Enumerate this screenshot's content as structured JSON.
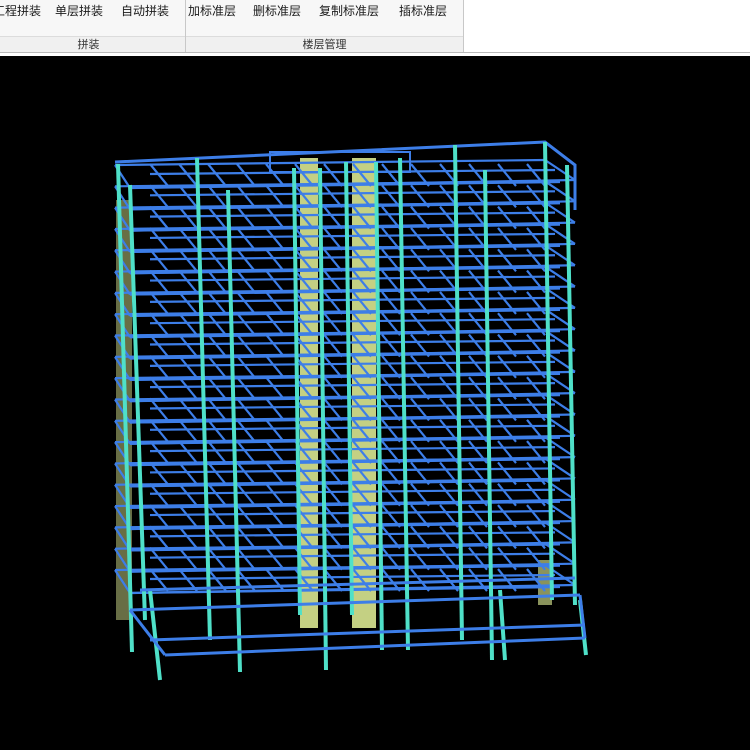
{
  "ribbon": {
    "groups": [
      {
        "name": "assemble",
        "label": "拼装",
        "buttons": [
          "工程拼装",
          "单层拼装",
          "自动拼装"
        ]
      },
      {
        "name": "floor-management",
        "label": "楼层管理",
        "buttons": [
          "加标准层",
          "删标准层",
          "复制标准层",
          "插标准层"
        ]
      }
    ]
  },
  "viewport": {
    "background": "#000000",
    "model": {
      "floors": 20,
      "beam_color": "#3d7ee8",
      "column_color": "#4fe0c8",
      "wall_color": "#e6f59a"
    }
  }
}
